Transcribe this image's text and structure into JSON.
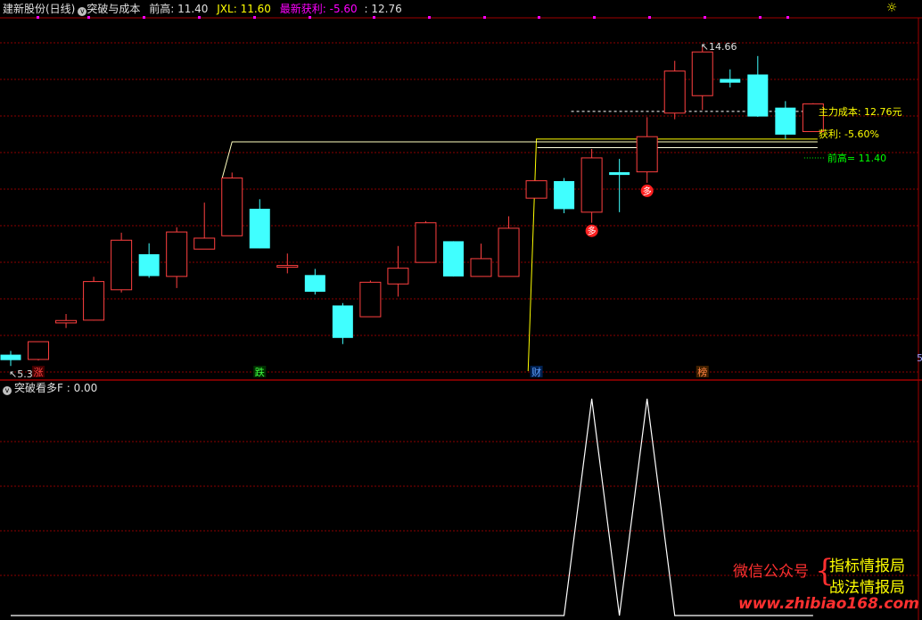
{
  "header": {
    "stock_name": "建新股份(日线)",
    "indicator_name": "突破与成本",
    "prev_high_label": "前高: 11.40",
    "jxl_label": "JXL: 11.60",
    "latest_profit_label": "最新获利: -5.60",
    "cost_value": ": 12.76",
    "menu_icon": "circle-chevron-down-icon"
  },
  "sub_header": {
    "indicator_name": "突破看多F",
    "value": ": 0.00",
    "menu_icon": "circle-chevron-down-icon"
  },
  "colors": {
    "up": "#ff4040",
    "down": "#40ffff",
    "yellow": "#ffff00",
    "white": "#ffffff",
    "green": "#00ff00",
    "magenta": "#ff00ff",
    "grid": "#8b0000"
  },
  "chart_data": [
    {
      "type": "candlestick",
      "title": "突破与成本",
      "candles": [
        {
          "open": 5.64,
          "close": 5.48,
          "high": 5.75,
          "low": 5.31
        },
        {
          "open": 5.5,
          "close": 6.02,
          "high": 6.03,
          "low": 5.47
        },
        {
          "open": 6.57,
          "close": 6.64,
          "high": 6.83,
          "low": 6.42
        },
        {
          "open": 6.65,
          "close": 7.78,
          "high": 7.92,
          "low": 6.64
        },
        {
          "open": 7.54,
          "close": 8.99,
          "high": 9.21,
          "low": 7.46
        },
        {
          "open": 8.58,
          "close": 7.94,
          "high": 8.9,
          "low": 7.89
        },
        {
          "open": 7.93,
          "close": 9.23,
          "high": 9.37,
          "low": 7.59
        },
        {
          "open": 8.73,
          "close": 9.05,
          "high": 10.09,
          "low": 8.73
        },
        {
          "open": 9.12,
          "close": 10.81,
          "high": 10.97,
          "low": 9.12
        },
        {
          "open": 9.91,
          "close": 8.75,
          "high": 10.19,
          "low": 8.75
        },
        {
          "open": 8.2,
          "close": 8.25,
          "high": 8.6,
          "low": 8.02
        },
        {
          "open": 7.97,
          "close": 7.48,
          "high": 8.15,
          "low": 7.4
        },
        {
          "open": 7.08,
          "close": 6.13,
          "high": 7.15,
          "low": 5.95
        },
        {
          "open": 6.75,
          "close": 7.76,
          "high": 7.81,
          "low": 6.75
        },
        {
          "open": 7.71,
          "close": 8.17,
          "high": 8.82,
          "low": 7.34
        },
        {
          "open": 8.34,
          "close": 9.5,
          "high": 9.55,
          "low": 8.34
        },
        {
          "open": 8.96,
          "close": 7.93,
          "high": 8.96,
          "low": 7.93
        },
        {
          "open": 7.93,
          "close": 8.45,
          "high": 8.89,
          "low": 7.93
        },
        {
          "open": 7.93,
          "close": 9.34,
          "high": 9.69,
          "low": 7.93
        },
        {
          "open": 10.22,
          "close": 10.73,
          "high": 10.73,
          "low": 10.22
        },
        {
          "open": 10.72,
          "close": 9.9,
          "high": 10.81,
          "low": 9.78
        },
        {
          "open": 9.81,
          "close": 11.4,
          "high": 11.66,
          "low": 9.5
        },
        {
          "open": 10.98,
          "close": 10.9,
          "high": 11.37,
          "low": 9.81
        },
        {
          "open": 10.99,
          "close": 12.02,
          "high": 12.59,
          "low": 10.67
        },
        {
          "open": 12.71,
          "close": 13.94,
          "high": 14.24,
          "low": 12.53
        },
        {
          "open": 13.22,
          "close": 14.5,
          "high": 14.66,
          "low": 12.8
        },
        {
          "open": 13.71,
          "close": 13.6,
          "high": 13.99,
          "low": 13.46
        },
        {
          "open": 13.84,
          "close": 12.61,
          "high": 14.38,
          "low": 12.6
        },
        {
          "open": 12.87,
          "close": 12.08,
          "high": 13.06,
          "low": 11.95
        },
        {
          "open": 12.17,
          "close": 12.98,
          "high": 13.0,
          "low": 12.17
        }
      ],
      "ylim": [
        4.95,
        15.55
      ],
      "annotations": {
        "low_price": "5.31",
        "high_price": "14.66",
        "main_cost": "主力成本: 12.76元",
        "profit": "获利: -5.60%",
        "prev_high_line": "前高= 11.40",
        "signal_duo": "多",
        "label_zhang": "涨",
        "label_die": "跌",
        "label_cai": "财",
        "label_bang": "榜",
        "axis_edge": "5"
      },
      "main_cost_value": 12.76,
      "prev_high_value": 11.4,
      "cost_curve_start_value": 5.16,
      "duo_signal_bars": [
        21,
        23
      ]
    },
    {
      "type": "line",
      "title": "突破看多F",
      "values": [
        0,
        0,
        0,
        0,
        0,
        0,
        0,
        0,
        0,
        0,
        0,
        0,
        0,
        0,
        0,
        0,
        0,
        0,
        0,
        0,
        0,
        1,
        0,
        1,
        0,
        0,
        0,
        0,
        0,
        0
      ],
      "ylim": [
        0,
        1
      ]
    }
  ],
  "watermark": {
    "line1": "微信公众号",
    "line2": "指标情报局",
    "line3": "战法情报局",
    "line4": "www.zhibiao168.com"
  }
}
